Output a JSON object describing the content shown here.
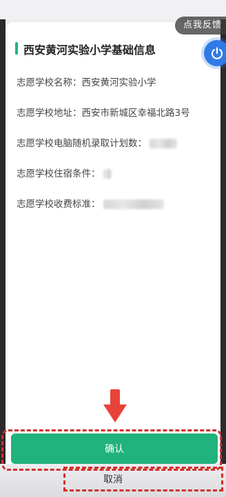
{
  "feedback_label": "点我反馈",
  "dialog": {
    "title": "西安黄河实验小学基础信息",
    "rows": [
      {
        "label": "志愿学校名称：",
        "value": "西安黄河实验小学"
      },
      {
        "label": "志愿学校地址：",
        "value": "西安市新城区幸福北路3号"
      },
      {
        "label": "志愿学校电脑随机录取计划数：",
        "value": ""
      },
      {
        "label": "志愿学校住宿条件：",
        "value": ""
      },
      {
        "label": "志愿学校收费标准：",
        "value": ""
      }
    ],
    "confirm_label": "确认",
    "cancel_label": "取消"
  },
  "colors": {
    "accent": "#21b37d",
    "annotation": "#d1302b",
    "power_button": "#2f7ae5"
  }
}
